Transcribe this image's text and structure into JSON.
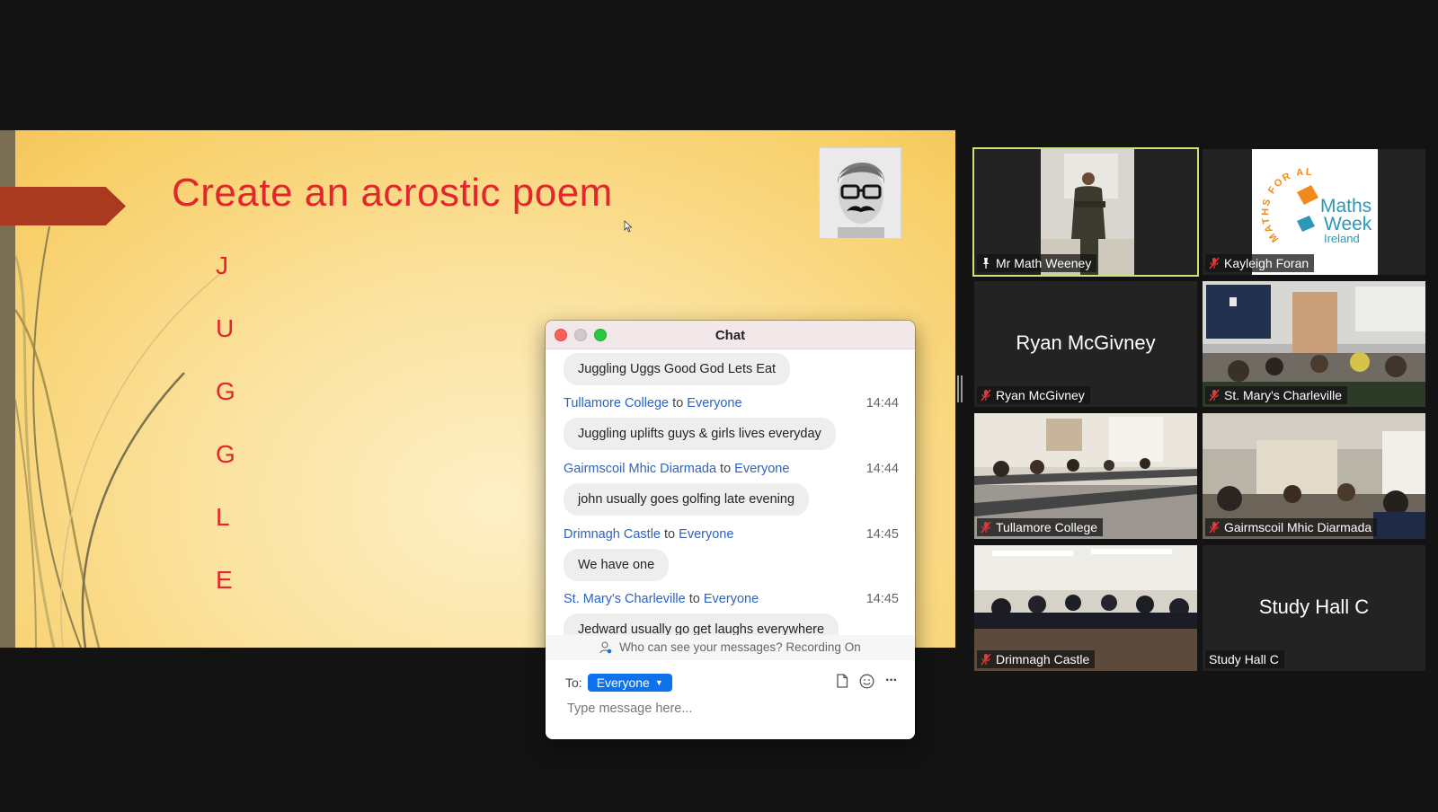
{
  "slide": {
    "title": "Create an acrostic poem",
    "letters": [
      "J",
      "U",
      "G",
      "G",
      "L",
      "E"
    ]
  },
  "chat": {
    "title": "Chat",
    "messages": [
      {
        "sender": "",
        "recipient": "",
        "time": "",
        "text": "Juggling Uggs Good God Lets Eat"
      },
      {
        "sender": "Tullamore College",
        "recipient": "Everyone",
        "time": "14:44",
        "text": "Juggling uplifts guys & girls lives everyday"
      },
      {
        "sender": "Gairmscoil Mhic Diarmada",
        "recipient": "Everyone",
        "time": "14:44",
        "text": "john usually goes golfing late evening"
      },
      {
        "sender": "Drimnagh Castle",
        "recipient": "Everyone",
        "time": "14:45",
        "text": "We have one"
      },
      {
        "sender": "St. Mary's Charleville",
        "recipient": "Everyone",
        "time": "14:45",
        "text": "Jedward usually go get laughs everywhere"
      }
    ],
    "to_word": "to",
    "notice": "Who can see your messages? Recording On",
    "to_label": "To:",
    "to_value": "Everyone",
    "placeholder": "Type message here...",
    "more_label": "···"
  },
  "participants": [
    {
      "name": "Mr Math Weeney",
      "type": "video-teacher",
      "muted": false,
      "pinned": true,
      "active": true
    },
    {
      "name": "Kayleigh Foran",
      "type": "logo",
      "muted": true
    },
    {
      "name": "Ryan McGivney",
      "type": "name-only",
      "muted": true
    },
    {
      "name": "St. Mary's Charleville",
      "type": "video-classroom",
      "muted": true
    },
    {
      "name": "Tullamore College",
      "type": "video-classroom",
      "muted": true
    },
    {
      "name": "Gairmscoil Mhic Diarmada",
      "type": "video-classroom",
      "muted": true
    },
    {
      "name": "Drimnagh Castle",
      "type": "video-classroom",
      "muted": true
    },
    {
      "name": "Study Hall C",
      "type": "name-only",
      "muted": false
    }
  ],
  "logo": {
    "arc_text": "MATHS FOR ALL",
    "line1": "Maths",
    "line2": "Week",
    "line3": "Ireland"
  },
  "colors": {
    "slide_text": "#e3262c",
    "arrow": "#a93a1f",
    "chat_link": "#2d63c4",
    "chip": "#0e72ed",
    "active_border": "#c8e67a",
    "mute_red": "#e03b3b",
    "logo_teal": "#2b98b8",
    "logo_orange": "#f08a1c"
  }
}
